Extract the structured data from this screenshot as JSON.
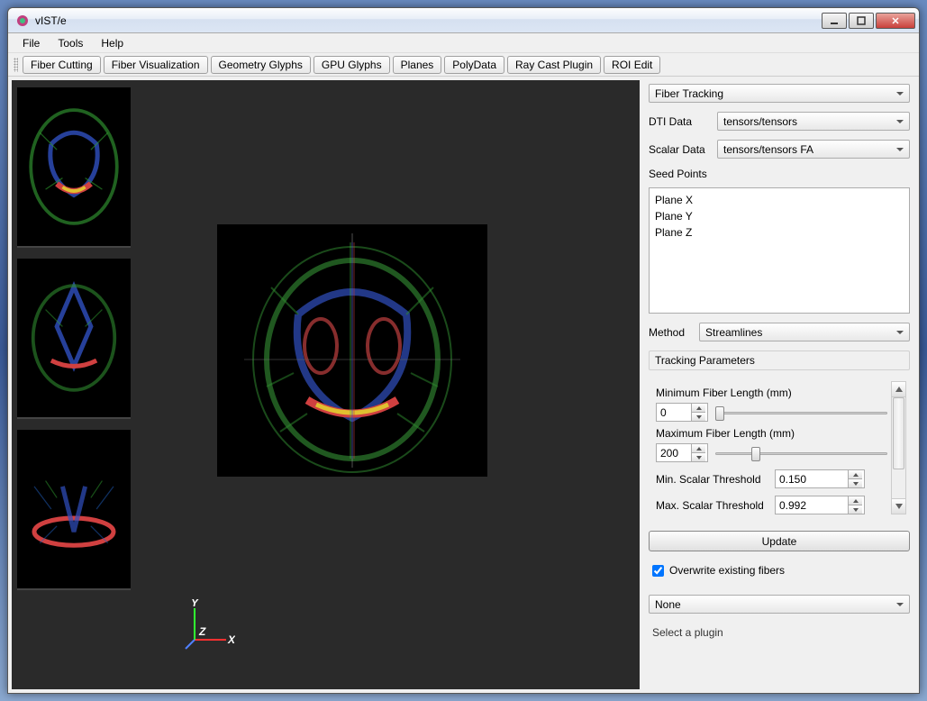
{
  "window": {
    "title": "vIST/e"
  },
  "menu": {
    "file": "File",
    "tools": "Tools",
    "help": "Help"
  },
  "toolbar": {
    "fiber_cutting": "Fiber Cutting",
    "fiber_vis": "Fiber Visualization",
    "geom_glyphs": "Geometry Glyphs",
    "gpu_glyphs": "GPU Glyphs",
    "planes": "Planes",
    "polydata": "PolyData",
    "raycast": "Ray Cast Plugin",
    "roi_edit": "ROI Edit"
  },
  "axis": {
    "x": "X",
    "y": "Y",
    "z": "Z"
  },
  "panel": {
    "plugin_selected": "Fiber Tracking",
    "dti_label": "DTI Data",
    "dti_value": "tensors/tensors",
    "scalar_label": "Scalar Data",
    "scalar_value": "tensors/tensors FA",
    "seed_label": "Seed Points",
    "seed_items": {
      "a": "Plane X",
      "b": "Plane Y",
      "c": "Plane Z"
    },
    "method_label": "Method",
    "method_value": "Streamlines",
    "params_title": "Tracking Parameters",
    "min_len_label": "Minimum Fiber Length (mm)",
    "min_len_value": "0",
    "max_len_label": "Maximum Fiber Length (mm)",
    "max_len_value": "200",
    "min_scalar_label": "Min. Scalar Threshold",
    "min_scalar_value": "0.150",
    "max_scalar_label": "Max. Scalar Threshold",
    "max_scalar_value": "0.992",
    "update": "Update",
    "overwrite": "Overwrite existing fibers",
    "bottom_combo": "None",
    "hint": "Select a plugin"
  }
}
